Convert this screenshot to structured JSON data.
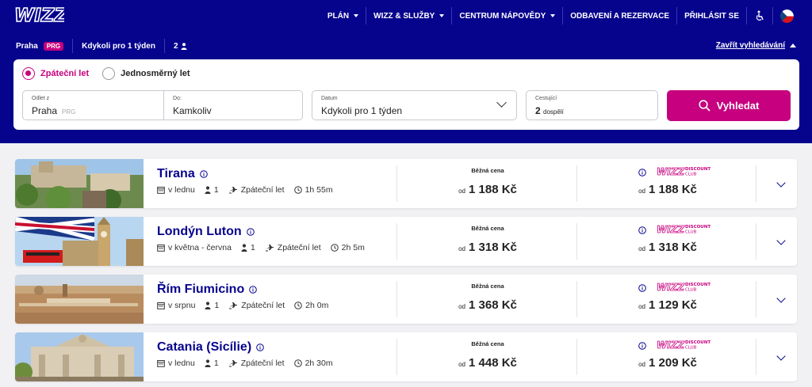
{
  "brand": {
    "logo_text": "WIZZ",
    "primary": "#06038d",
    "accent": "#c6007e"
  },
  "nav": {
    "items": [
      "PLÁN",
      "WIZZ & SLUŽBY",
      "CENTRUM NÁPOVĚDY",
      "ODBAVENÍ A REZERVACE",
      "PŘIHLÁSIT SE"
    ],
    "icons": [
      "accessibility-icon",
      "czech-flag-icon"
    ]
  },
  "summary": {
    "origin": "Praha",
    "origin_code": "PRG",
    "when": "Kdykoli pro 1 týden",
    "passengers": "2",
    "close_label": "Zavřít vyhledávání"
  },
  "search": {
    "trip_types": [
      "Zpáteční let",
      "Jednosměrný let"
    ],
    "selected_trip": "Zpáteční let",
    "from_label": "Odlet z",
    "from_value": "Praha",
    "from_code": "PRG",
    "to_label": "Do:",
    "to_value": "Kamkoliv",
    "date_label": "Datum",
    "date_value": "Kdykoli pro 1 týden",
    "pax_label": "Cestující",
    "pax_count": "2",
    "pax_unit": "dospělí",
    "button_label": "Vyhledat"
  },
  "results": {
    "regular_label": "Běžná cena",
    "from_prefix": "od",
    "club_logo": "WIZZ DISCOUNT CLUB",
    "items": [
      {
        "city": "Tirana",
        "when": "v lednu",
        "pax": "1",
        "trip": "Zpáteční let",
        "duration": "1h 55m",
        "regular": "1 188 Kč",
        "club": "1 188 Kč"
      },
      {
        "city": "Londýn Luton",
        "when": "v května - června",
        "pax": "1",
        "trip": "Zpáteční let",
        "duration": "2h 5m",
        "regular": "1 318 Kč",
        "club": "1 318 Kč"
      },
      {
        "city": "Řím Fiumicino",
        "when": "v srpnu",
        "pax": "1",
        "trip": "Zpáteční let",
        "duration": "2h 0m",
        "regular": "1 368 Kč",
        "club": "1 129 Kč"
      },
      {
        "city": "Catania (Sicílie)",
        "when": "v lednu",
        "pax": "1",
        "trip": "Zpáteční let",
        "duration": "2h 30m",
        "regular": "1 448 Kč",
        "club": "1 209 Kč"
      }
    ]
  }
}
